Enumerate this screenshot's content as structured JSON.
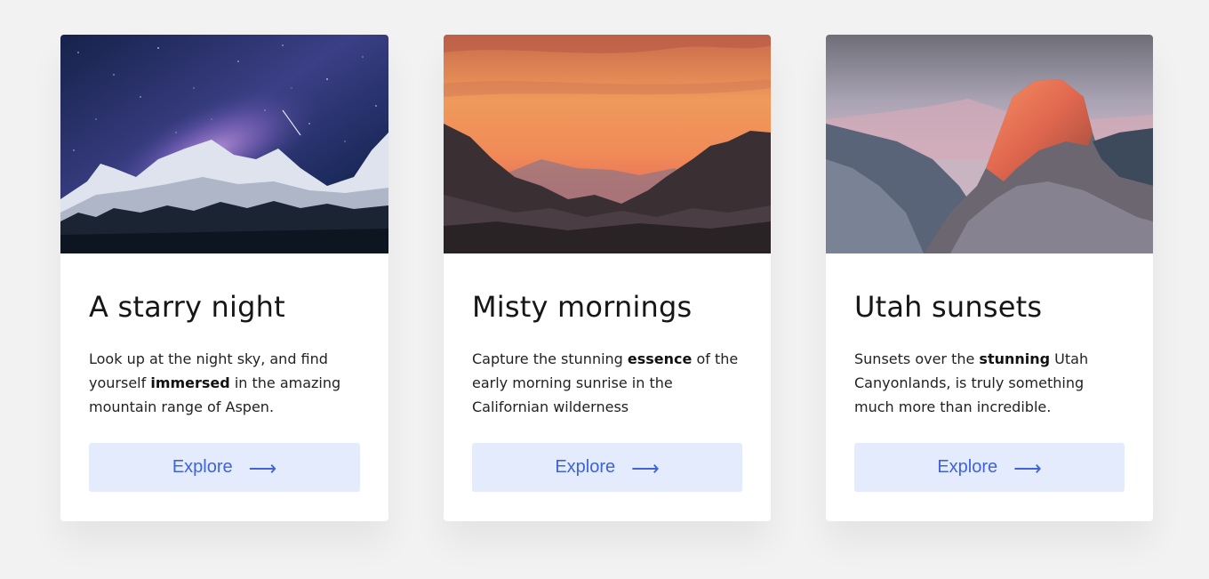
{
  "cards": [
    {
      "title": "A starry night",
      "desc_before": "Look up at the night sky, and find yourself ",
      "desc_bold": "immersed",
      "desc_after": " in the amazing mountain range of Aspen.",
      "button_label": "Explore",
      "arrow": "⟶"
    },
    {
      "title": "Misty mornings",
      "desc_before": "Capture the stunning ",
      "desc_bold": "essence",
      "desc_after": " of the early morning sunrise in the Californian wilderness",
      "button_label": "Explore",
      "arrow": "⟶"
    },
    {
      "title": "Utah sunsets",
      "desc_before": "Sunsets over the ",
      "desc_bold": "stunning",
      "desc_after": " Utah Canyonlands, is truly something much more than incredible.",
      "button_label": "Explore",
      "arrow": "⟶"
    }
  ],
  "colors": {
    "page_background": "#f2f2f2",
    "card_background": "#ffffff",
    "button_background": "#e3ebfd",
    "button_text": "#3f63d8"
  }
}
